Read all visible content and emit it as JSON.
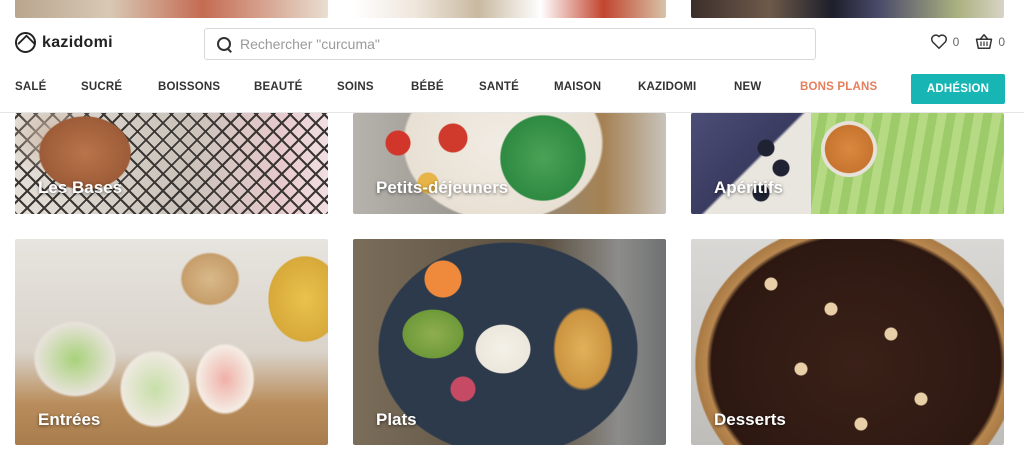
{
  "brand": {
    "name": "kazidomi"
  },
  "search": {
    "placeholder": "Rechercher \"curcuma\""
  },
  "header": {
    "wishlist_count": "0",
    "cart_count": "0"
  },
  "nav": {
    "items": [
      "SALÉ",
      "SUCRÉ",
      "BOISSONS",
      "BEAUTÉ",
      "SOINS",
      "BÉBÉ",
      "SANTÉ",
      "MAISON",
      "KAZIDOMI",
      "NEW"
    ],
    "promo": "BONS PLANS",
    "join": "ADHÉSION"
  },
  "colors": {
    "accent": "#17b6b5",
    "promo": "#e67e5c"
  },
  "categories": [
    {
      "label": "Les Bases"
    },
    {
      "label": "Petits-déjeuners"
    },
    {
      "label": "Apéritifs"
    },
    {
      "label": "Entrées"
    },
    {
      "label": "Plats"
    },
    {
      "label": "Desserts"
    }
  ]
}
